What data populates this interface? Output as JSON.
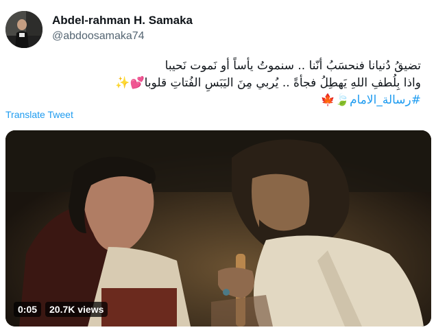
{
  "author": {
    "display_name": "Abdel-rahman H. Samaka",
    "handle": "@abdoosamaka74"
  },
  "tweet": {
    "line1": "تضيقُ دُنيانا فنحسَبُ أنّنا .. سنموتُ يأساً أو نَموت نَحيبا",
    "line2": "واذا بِلُطفِ اللهِ يَهطِلُ فجأةً .. يُربي مِنَ اليَبَسِ الفُتاتِ قلوبا",
    "line2_emoji": "💕✨",
    "hashtag": "#رسالة_الامام",
    "hashtag_emoji": "🍃🍁"
  },
  "translate_label": "Translate Tweet",
  "video": {
    "time": "0:05",
    "views": "20.7K views"
  }
}
